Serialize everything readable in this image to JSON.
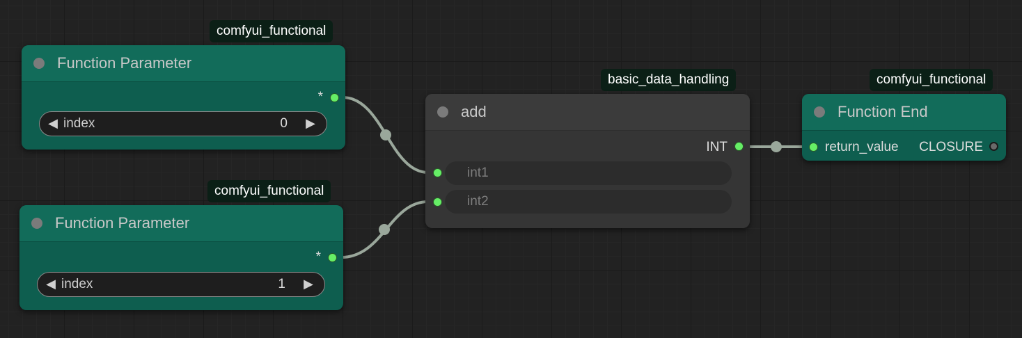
{
  "colors": {
    "canvas_bg": "#222222",
    "node_green_title": "#126c5a",
    "node_green_body": "#0e5e4f",
    "node_gray_body": "#353535",
    "slot_active": "#66ee66",
    "link": "#9aa79b",
    "badge_bg": "#0b1f16"
  },
  "nodes": {
    "param1": {
      "badge": "comfyui_functional",
      "title": "Function Parameter",
      "output_label": "*",
      "widget": {
        "label": "index",
        "value": "0"
      }
    },
    "param2": {
      "badge": "comfyui_functional",
      "title": "Function Parameter",
      "output_label": "*",
      "widget": {
        "label": "index",
        "value": "1"
      }
    },
    "add": {
      "badge": "basic_data_handling",
      "title": "add",
      "output_label": "INT",
      "inputs": [
        "int1",
        "int2"
      ]
    },
    "end": {
      "badge": "comfyui_functional",
      "title": "Function End",
      "input_label": "return_value",
      "output_label": "CLOSURE"
    }
  },
  "icons": {
    "title_dot": "circle-icon",
    "decrement": "triangle-left-icon",
    "increment": "triangle-right-icon"
  },
  "glyphs": {
    "left_arrow": "◀",
    "right_arrow": "▶"
  }
}
